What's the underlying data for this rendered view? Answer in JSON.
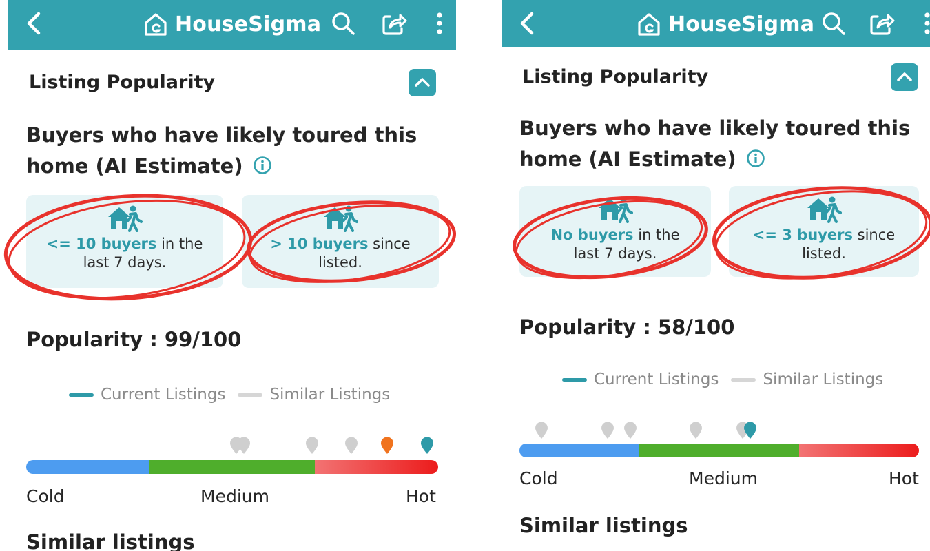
{
  "panels": [
    {
      "app_title": "HouseSigma",
      "section_title": "Listing Popularity",
      "subhead_line1": "Buyers who have likely toured this",
      "subhead_line2": "home (AI Estimate)",
      "card1": {
        "highlight": "<= 10 buyers",
        "rest": " in the",
        "line2": "last 7 days."
      },
      "card2": {
        "highlight": "> 10 buyers",
        "rest": " since",
        "line2": "listed."
      },
      "popularity_label": "Popularity : 99/100",
      "popularity_score": 99,
      "legend_current": "Current Listings",
      "legend_similar": "Similar Listings",
      "scale_cold": "Cold",
      "scale_medium": "Medium",
      "scale_hot": "Hot",
      "similar_heading": "Similar listings",
      "current_pin_value": 99,
      "similar_pin_values": [
        51,
        53,
        70,
        80,
        89
      ]
    },
    {
      "app_title": "HouseSigma",
      "section_title": "Listing Popularity",
      "subhead_line1": "Buyers who have likely toured this",
      "subhead_line2": "home (AI Estimate)",
      "card1": {
        "highlight": "No buyers",
        "rest": " in the",
        "line2": "last 7 days."
      },
      "card2": {
        "highlight": "<= 3 buyers",
        "rest": " since",
        "line2": "listed."
      },
      "popularity_label": "Popularity : 58/100",
      "popularity_score": 58,
      "legend_current": "Current Listings",
      "legend_similar": "Similar Listings",
      "scale_cold": "Cold",
      "scale_medium": "Medium",
      "scale_hot": "Hot",
      "similar_heading": "Similar listings",
      "current_pin_value": 58,
      "similar_pin_values": [
        4,
        21,
        27,
        44,
        56
      ]
    }
  ],
  "colors": {
    "brand_teal": "#33a2af",
    "card_bg": "#e6f4f6",
    "cold": "#4d9cf0",
    "medium": "#4fae2c",
    "hot": "#ec1c1c",
    "similar_pin": "#cfcfcf",
    "current_pin": "#2e9aa8",
    "highlight_pin": "#f0731e",
    "annotation_ring": "#e8322c"
  },
  "icons": [
    "back-arrow-icon",
    "house-logo-icon",
    "search-icon",
    "share-icon",
    "more-vertical-icon",
    "chevron-up-icon",
    "info-icon",
    "house-walker-icon",
    "map-pin-icon"
  ]
}
